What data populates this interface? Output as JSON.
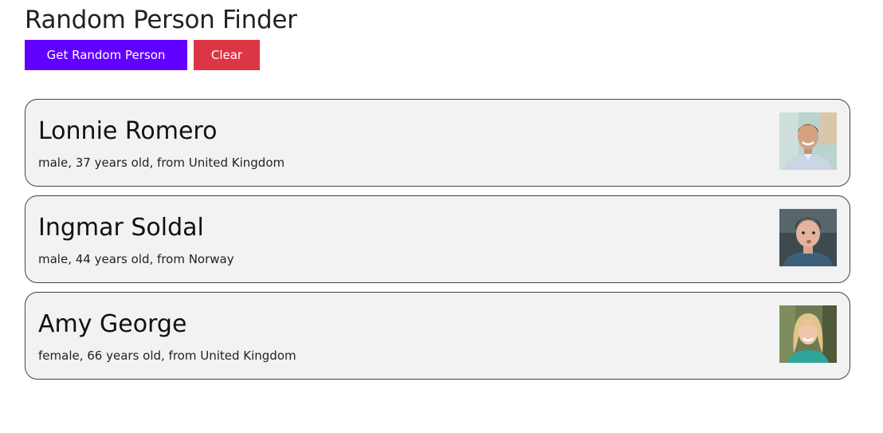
{
  "header": {
    "title": "Random Person Finder"
  },
  "toolbar": {
    "get_random_label": "Get Random Person",
    "clear_label": "Clear"
  },
  "colors": {
    "primary_button": "#6200ff",
    "danger_button": "#dc3545",
    "card_background": "#f2f2f2",
    "card_border": "#444444"
  },
  "people": [
    {
      "name": "Lonnie Romero",
      "info": "male, 37 years old, from United Kingdom",
      "avatar_icon": "man-portrait-photo"
    },
    {
      "name": "Ingmar Soldal",
      "info": "male, 44 years old, from Norway",
      "avatar_icon": "man-portrait-photo"
    },
    {
      "name": "Amy George",
      "info": "female, 66 years old, from United Kingdom",
      "avatar_icon": "woman-portrait-photo"
    }
  ]
}
